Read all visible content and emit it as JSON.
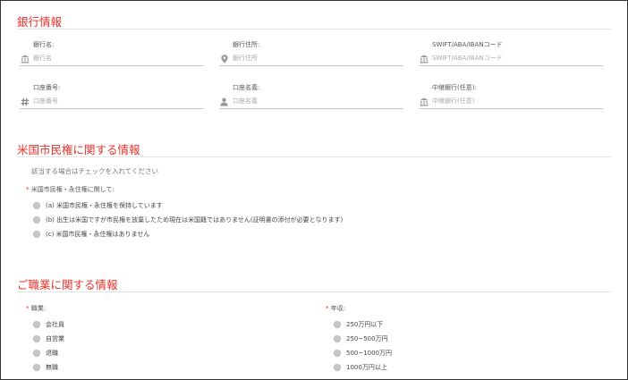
{
  "bank": {
    "title": "銀行情報",
    "fields": [
      {
        "label": "銀行名:",
        "placeholder": "銀行名",
        "icon": "bank-icon"
      },
      {
        "label": "銀行住所:",
        "placeholder": "銀行住所",
        "icon": "map-marker-icon"
      },
      {
        "label": "SWIFT/ABA/IBANコード",
        "placeholder": "SWIFT/ABA/IBANコード",
        "icon": "bank-icon"
      },
      {
        "label": "口座番号:",
        "placeholder": "口座番号",
        "icon": "hash-icon"
      },
      {
        "label": "口座名義:",
        "placeholder": "口座名義",
        "icon": "user-icon"
      },
      {
        "label": "中継銀行(任意):",
        "placeholder": "中継銀行(任意)",
        "icon": "bank-icon"
      }
    ]
  },
  "citizenship": {
    "title": "米国市民権に関する情報",
    "note": "該当する場合はチェックを入れてください",
    "required_mark": "*",
    "question": "米国市民権・永住権に関して:",
    "options": [
      "(a) 米国市民権・永住権を保持しています",
      "(b) 出生は米国ですが市民権を放棄したため現在は米国籍ではありません(証明書の添付が必要となります)",
      "(c) 米国市民権・永住権はありません"
    ]
  },
  "occupation": {
    "title": "ご職業に関する情報",
    "required_mark": "*",
    "job_label": "職業:",
    "job_options": [
      "会社員",
      "自営業",
      "退職",
      "無職"
    ],
    "income_label": "年収:",
    "income_options": [
      "250万円以下",
      "250~500万円",
      "500~1000万円",
      "1000万円以上"
    ]
  },
  "colors": {
    "accent": "#e6322b",
    "radio_fill": "#c9c9c9",
    "rule": "#e3e3e3"
  }
}
